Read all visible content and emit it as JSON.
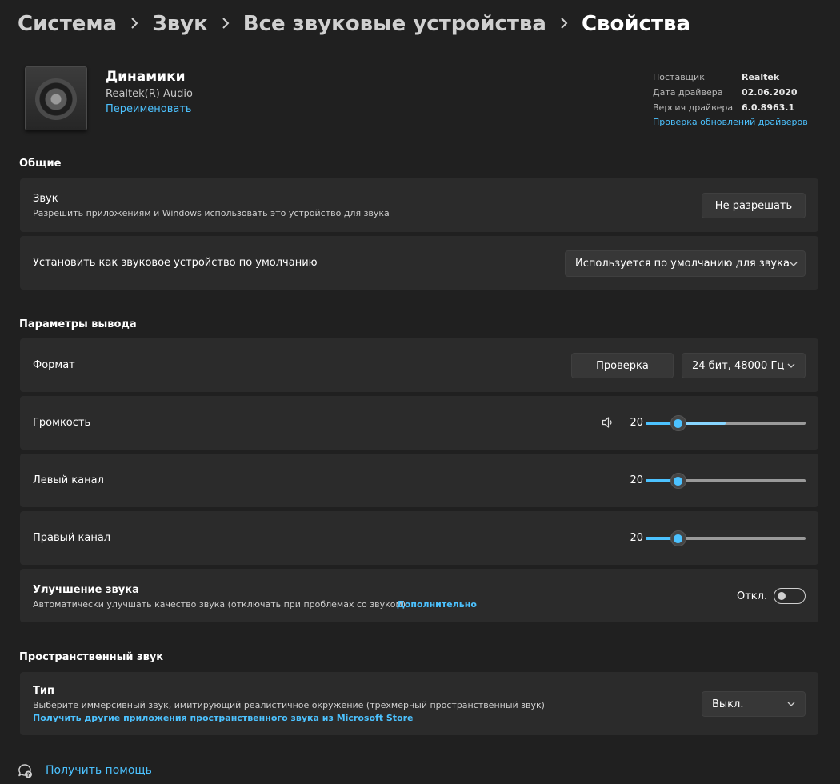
{
  "breadcrumb": [
    "Система",
    "Звук",
    "Все звуковые устройства",
    "Свойства"
  ],
  "device": {
    "name": "Динамики",
    "vendor": "Realtek(R) Audio",
    "rename_link": "Переименовать",
    "icon": "speaker-device-icon"
  },
  "driver": {
    "supplier_label": "Поставщик",
    "supplier_value": "Realtek",
    "date_label": "Дата драйвера",
    "date_value": "02.06.2020",
    "version_label": "Версия драйвера",
    "version_value": "6.0.8963.1",
    "update_link": "Проверка обновлений драйверов"
  },
  "general": {
    "title": "Общие",
    "audio": {
      "title": "Звук",
      "description": "Разрешить приложениям и Windows использовать это устройство для звука",
      "button": "Не разрешать"
    },
    "default_device": {
      "title": "Установить как звуковое устройство по умолчанию",
      "selected": "Используется по умолчанию для звука"
    }
  },
  "output": {
    "title": "Параметры вывода",
    "format": {
      "title": "Формат",
      "test_button": "Проверка",
      "selected": "24 бит, 48000 Гц"
    },
    "volume": {
      "title": "Громкость",
      "value": "20",
      "level": 0.2,
      "icon": "speaker-volume-icon"
    },
    "left": {
      "title": "Левый канал",
      "value": "20",
      "level": 0.2
    },
    "right": {
      "title": "Правый канал",
      "value": "20",
      "level": 0.2
    },
    "enhance": {
      "title": "Улучшение звука",
      "description": "Автоматически улучшать качество звука (отключать при проблемах со звуком)",
      "link": "Дополнительно",
      "state": "Откл.",
      "on": false
    }
  },
  "spatial": {
    "title": "Пространственный звук",
    "type": {
      "title": "Тип",
      "description": "Выберите иммерсивный звук, имитирующий реалистичное окружение (трехмерный пространственный звук)",
      "store_link": "Получить другие приложения пространственного звука из Microsoft Store",
      "selected": "Выкл."
    }
  },
  "help": {
    "label": "Получить помощь",
    "icon": "help-chat-icon"
  },
  "colors": {
    "background": "#202020",
    "card": "#2b2b2b",
    "accent": "#4cc2ff"
  }
}
